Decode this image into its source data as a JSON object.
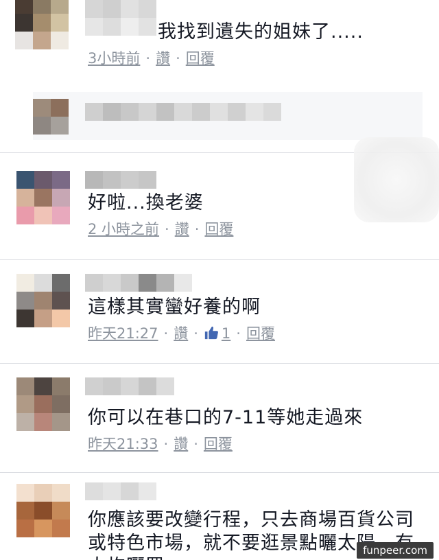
{
  "comments": [
    {
      "text": "我找到遺失的姐妹了.....",
      "time": "3小時前",
      "like": "讚",
      "reply": "回覆"
    },
    {
      "text": "好啦...換老婆",
      "time": "2 小時之前",
      "like": "讚",
      "reply": "回覆"
    },
    {
      "text": "這樣其實蠻好養的啊",
      "time": "昨天21:27",
      "like": "讚",
      "like_count": "1",
      "reply": "回覆"
    },
    {
      "text": "你可以在巷口的7-11等她走過來",
      "time": "昨天21:33",
      "like": "讚",
      "reply": "回覆"
    },
    {
      "text": "你應該要改變行程，只去商場百貨公司或特色市場，就不要逛景點曬太陽，有大枸曬罩"
    }
  ],
  "watermark": "funpeer.com",
  "colors": {
    "text": "#141823",
    "meta": "#9197a3",
    "like_blue": "#4267b2"
  }
}
